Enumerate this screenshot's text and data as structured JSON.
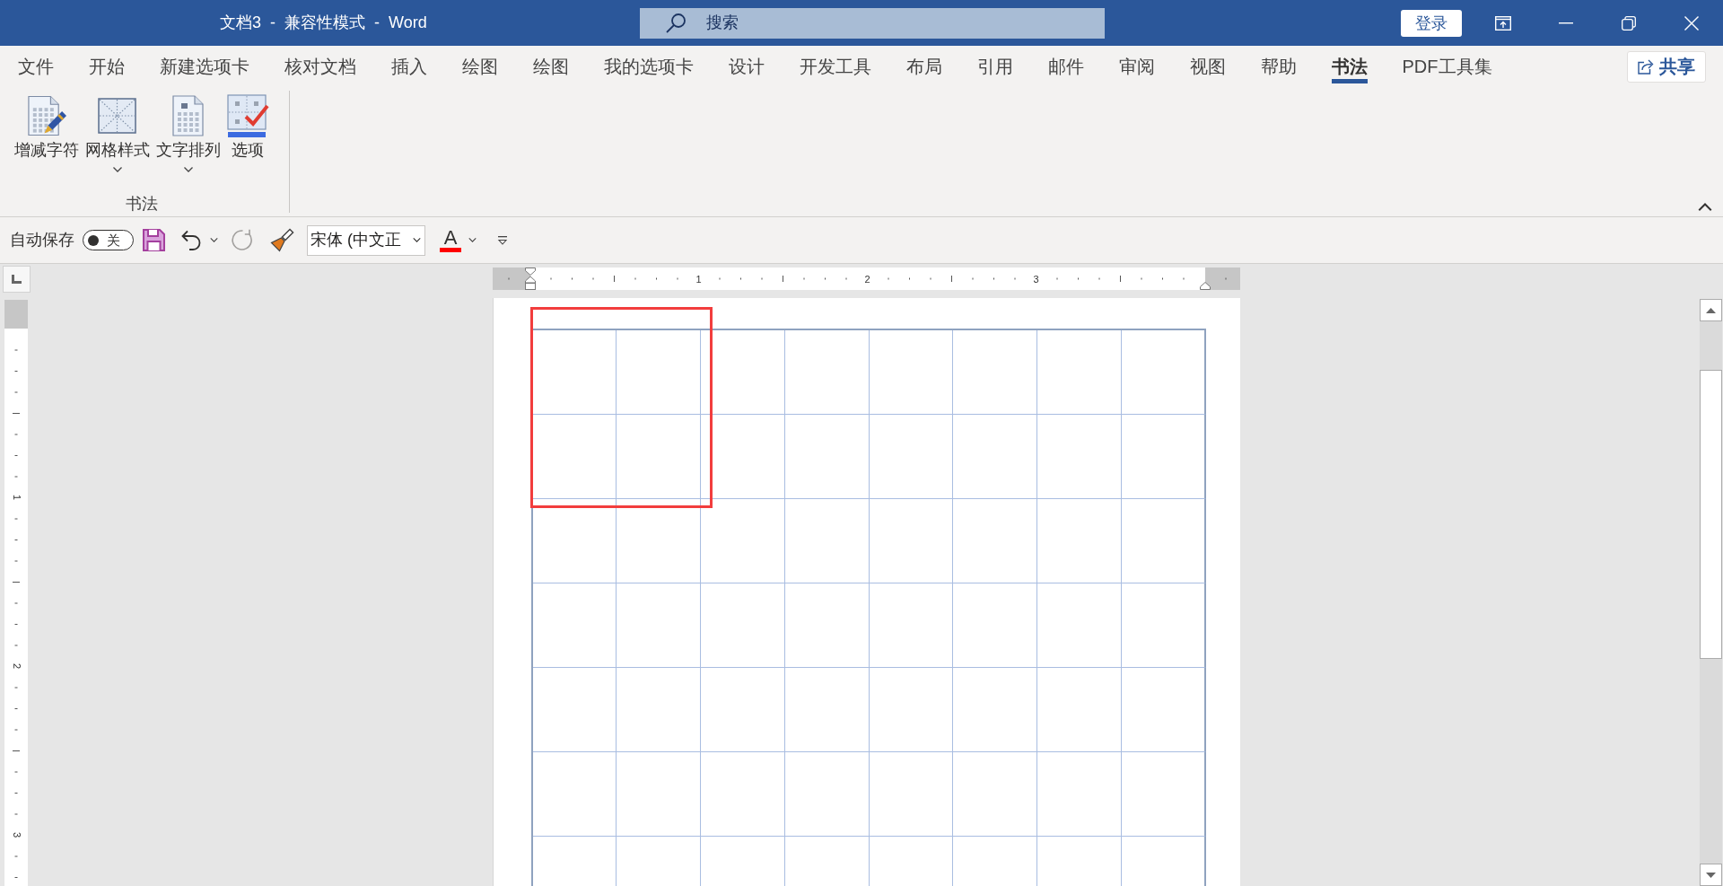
{
  "window": {
    "title": "文档3  -  兼容性模式  -  Word"
  },
  "search": {
    "placeholder": "搜索"
  },
  "account": {
    "sign_in": "登录"
  },
  "tabs": [
    {
      "label": "文件",
      "selected": false
    },
    {
      "label": "开始",
      "selected": false
    },
    {
      "label": "新建选项卡",
      "selected": false
    },
    {
      "label": "核对文档",
      "selected": false
    },
    {
      "label": "插入",
      "selected": false
    },
    {
      "label": "绘图",
      "selected": false
    },
    {
      "label": "绘图",
      "selected": false
    },
    {
      "label": "我的选项卡",
      "selected": false
    },
    {
      "label": "设计",
      "selected": false
    },
    {
      "label": "开发工具",
      "selected": false
    },
    {
      "label": "布局",
      "selected": false
    },
    {
      "label": "引用",
      "selected": false
    },
    {
      "label": "邮件",
      "selected": false
    },
    {
      "label": "审阅",
      "selected": false
    },
    {
      "label": "视图",
      "selected": false
    },
    {
      "label": "帮助",
      "selected": false
    },
    {
      "label": "书法",
      "selected": true
    },
    {
      "label": "PDF工具集",
      "selected": false
    }
  ],
  "share": {
    "label": "共享"
  },
  "ribbon": {
    "groups": [
      {
        "label": "书法",
        "buttons": [
          {
            "label": "增减字符",
            "kind": "add_remove",
            "has_menu": false
          },
          {
            "label": "网格样式",
            "kind": "grid_style",
            "has_menu": true
          },
          {
            "label": "文字排列",
            "kind": "text_direction",
            "has_menu": true
          },
          {
            "label": "选项",
            "kind": "options",
            "has_menu": false
          }
        ]
      }
    ]
  },
  "quick_access": {
    "autosave": {
      "label": "自动保存",
      "on": false,
      "state_label": "关"
    },
    "tools": [
      {
        "kind": "save",
        "disabled": false,
        "has_menu": false
      },
      {
        "kind": "undo",
        "disabled": false,
        "has_menu": true
      },
      {
        "kind": "redo",
        "disabled": true,
        "has_menu": false
      },
      {
        "kind": "format_painter",
        "disabled": false,
        "has_menu": false
      }
    ],
    "font": {
      "value": "宋体 (中文正"
    },
    "font_color": {
      "label": "A"
    }
  },
  "rulers": {
    "horizontal": [
      "1",
      "2",
      "3"
    ],
    "vertical": [
      "1",
      "2",
      "3"
    ]
  }
}
